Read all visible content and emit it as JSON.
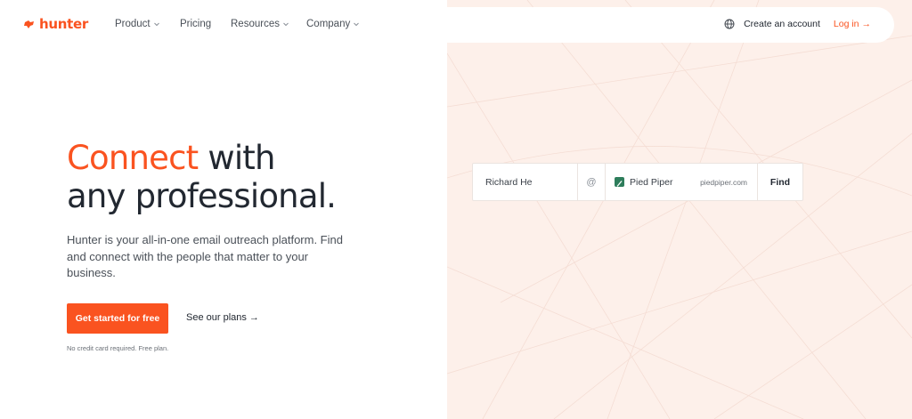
{
  "brand": {
    "name": "hunter",
    "color": "#fa5320"
  },
  "nav": {
    "links": [
      {
        "label": "Product",
        "dropdown": true
      },
      {
        "label": "Pricing",
        "dropdown": false
      },
      {
        "label": "Resources",
        "dropdown": true
      },
      {
        "label": "Company",
        "dropdown": true
      }
    ],
    "globe_icon": "globe-icon",
    "create_account": "Create an account",
    "login": "Log in",
    "login_arrow": "→"
  },
  "hero": {
    "headline_accent": "Connect",
    "headline_rest": " with",
    "headline_line2": "any professional.",
    "subtext": "Hunter is your all-in-one email outreach platform. Find and connect with the people that matter to your business.",
    "cta": "Get started for free",
    "plans": "See our plans",
    "plans_arrow": "→",
    "note": "No credit card required. Free plan."
  },
  "finder": {
    "name_value": "Richard He",
    "at_symbol": "@",
    "company_name": "Pied Piper",
    "company_domain": "piedpiper.com",
    "find_label": "Find"
  }
}
